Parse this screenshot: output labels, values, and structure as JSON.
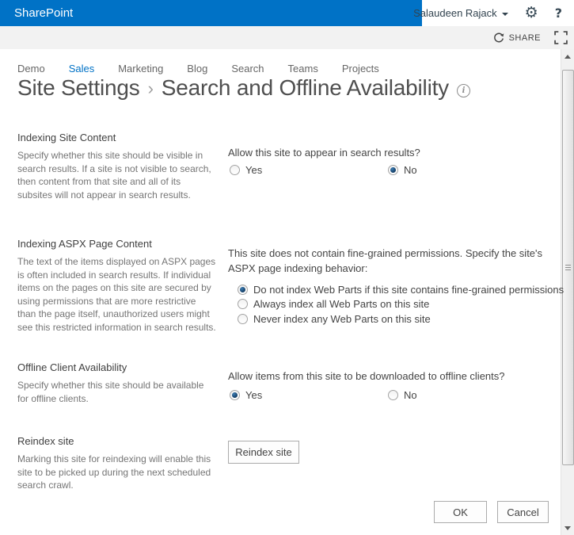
{
  "suite_bar": {
    "brand": "SharePoint",
    "user_name": "Salaudeen Rajack"
  },
  "ribbon": {
    "share_label": "SHARE"
  },
  "icons": {
    "gear": "⚙",
    "help": "?",
    "info": "i",
    "breadcrumb_chevron": "›",
    "share_icon_name": "share-sync-circle",
    "focus_icon_name": "focus-on-content"
  },
  "colors": {
    "suite_bar_blue": "#0072C6",
    "active_tab_blue": "#0072C6",
    "selected_radio_navy": "#1b4a75",
    "ribbon_gray": "#f2f2f2"
  },
  "nav": {
    "items": [
      {
        "label": "Demo",
        "active": false
      },
      {
        "label": "Sales",
        "active": true
      },
      {
        "label": "Marketing",
        "active": false
      },
      {
        "label": "Blog",
        "active": false
      },
      {
        "label": "Search",
        "active": false
      },
      {
        "label": "Teams",
        "active": false
      },
      {
        "label": "Projects",
        "active": false
      }
    ]
  },
  "page": {
    "breadcrumb_root": "Site Settings",
    "title": "Search and Offline Availability"
  },
  "sections": [
    {
      "heading": "Indexing Site Content",
      "description": "Specify whether this site should be visible in search results. If a site is not visible to search, then content from that site and all of its subsites will not appear in search results.",
      "question": "Allow this site to appear in search results?",
      "options": [
        {
          "label": "Yes",
          "selected": false
        },
        {
          "label": "No",
          "selected": true
        }
      ]
    },
    {
      "heading": "Indexing ASPX Page Content",
      "description": "The text of the items displayed on ASPX pages is often included in search results. If individual items on the pages on this site are secured by using permissions that are more restrictive than the page itself, unauthorized users might see this restricted information in search results.",
      "question": "This site does not contain fine-grained permissions. Specify the site's ASPX page indexing behavior:",
      "options": [
        {
          "label": "Do not index Web Parts if this site contains fine-grained permissions",
          "selected": true
        },
        {
          "label": "Always index all Web Parts on this site",
          "selected": false
        },
        {
          "label": "Never index any Web Parts on this site",
          "selected": false
        }
      ]
    },
    {
      "heading": "Offline Client Availability",
      "description": "Specify whether this site should be available for offline clients.",
      "question": "Allow items from this site to be downloaded to offline clients?",
      "options": [
        {
          "label": "Yes",
          "selected": true
        },
        {
          "label": "No",
          "selected": false
        }
      ]
    },
    {
      "heading": "Reindex site",
      "description": "Marking this site for reindexing will enable this site to be picked up during the next scheduled search crawl.",
      "button_label": "Reindex site"
    }
  ],
  "footer": {
    "ok_label": "OK",
    "cancel_label": "Cancel"
  }
}
